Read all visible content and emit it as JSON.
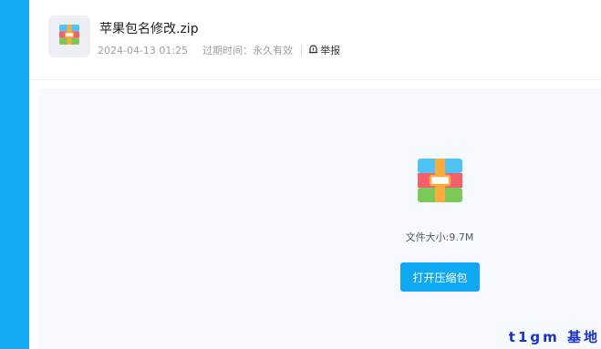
{
  "file": {
    "name": "苹果包名修改.zip",
    "upload_time": "2024-04-13 01:25",
    "expire_label": "过期时间：永久有效",
    "report_label": "举报",
    "size_text": "文件大小:9.7M"
  },
  "actions": {
    "open_label": "打开压缩包"
  },
  "icons": {
    "file_type": "zip-archive-icon",
    "report": "report-flag-icon"
  },
  "watermark": "t1gm 基地",
  "colors": {
    "sidebar": "#15aaf2",
    "primary_button": "#0fa9f3",
    "panel_bg": "#f6f9fd",
    "watermark": "#1733c9"
  }
}
